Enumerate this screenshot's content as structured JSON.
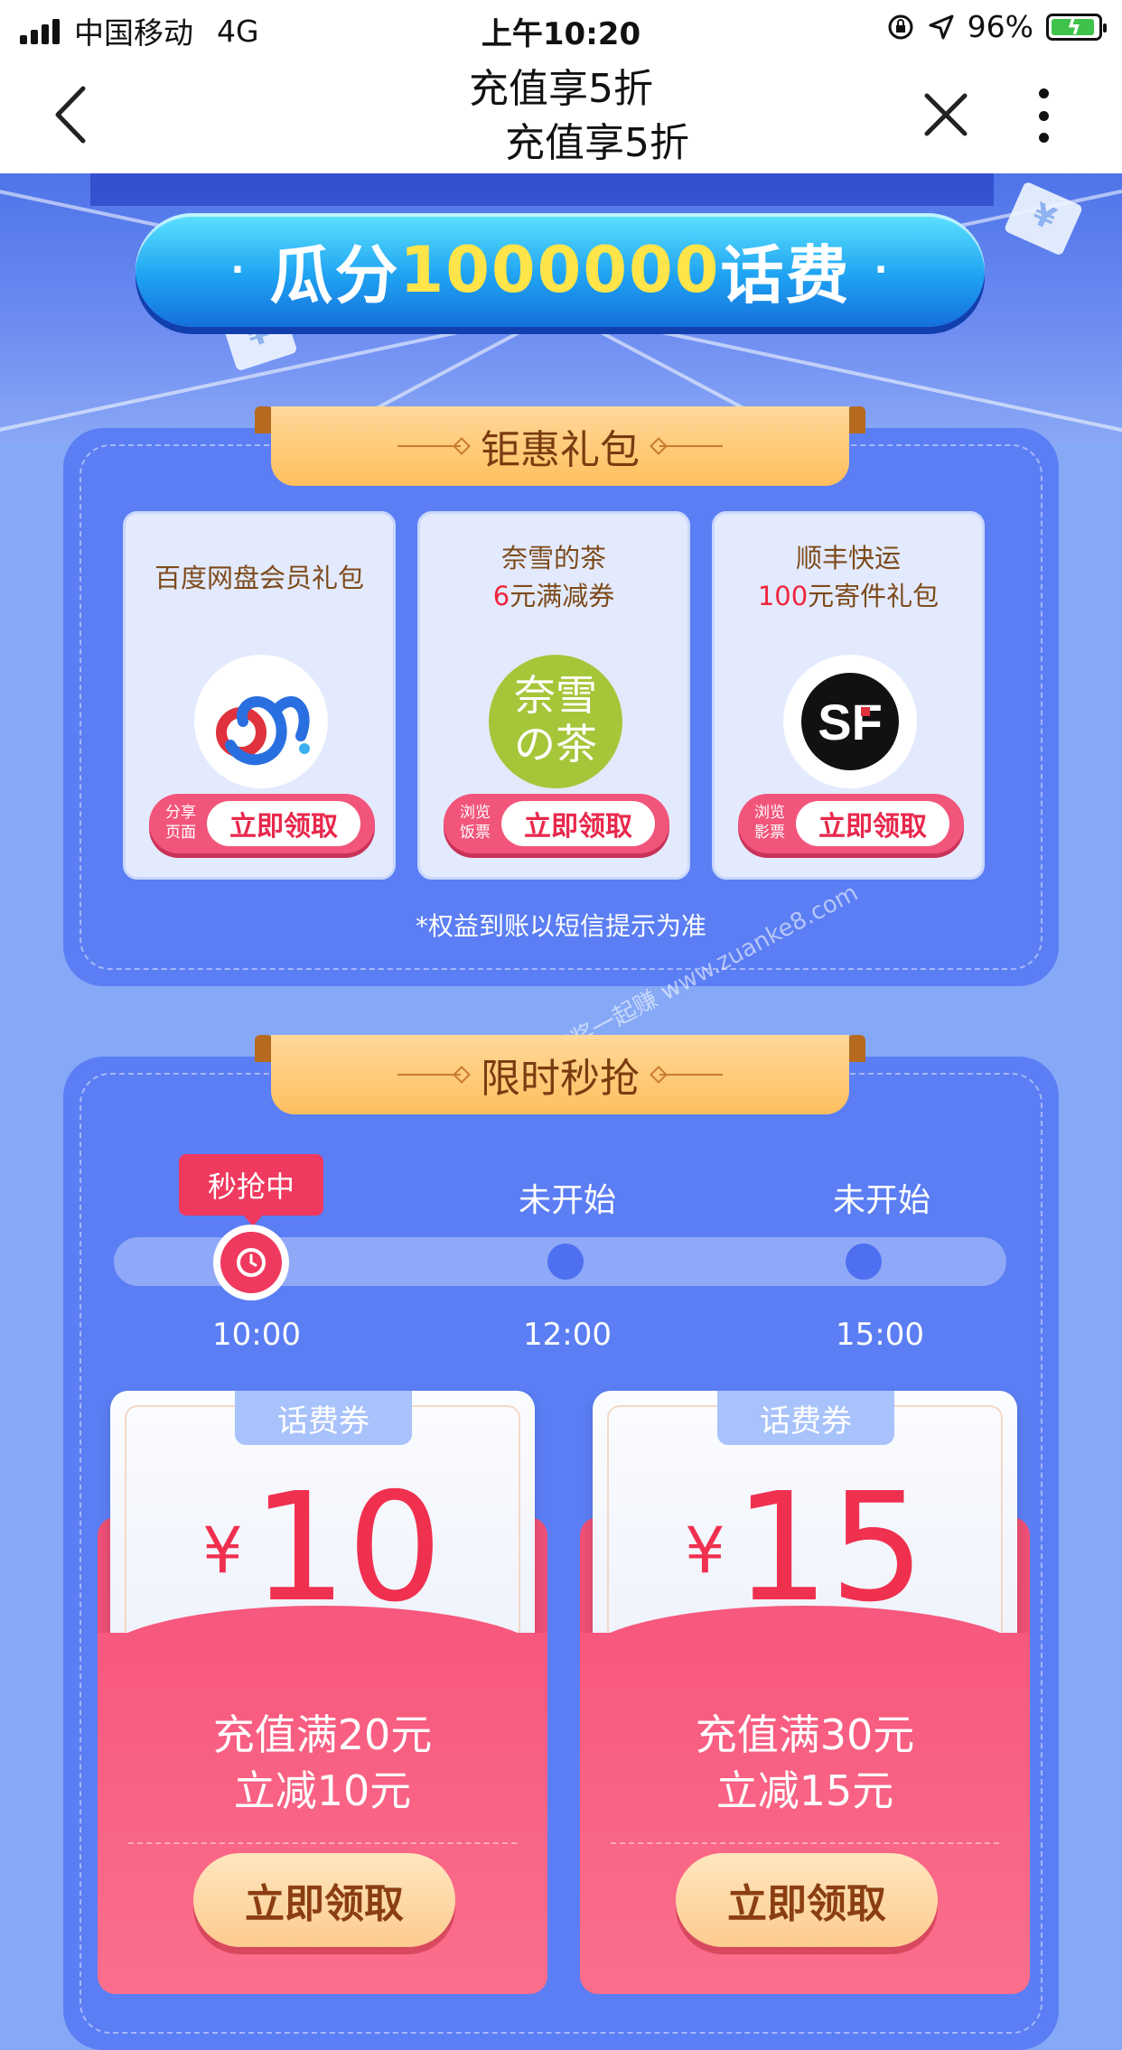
{
  "status_bar": {
    "carrier": "中国移动",
    "network": "4G",
    "time": "上午10:20",
    "battery": "96%"
  },
  "nav": {
    "title": "充值享5折",
    "title_echo": "充值享5折"
  },
  "hero": {
    "banner_prefix": "瓜分",
    "banner_number": "1000000",
    "banner_suffix": "话费",
    "bullet": "·",
    "paper_symbol": "¥"
  },
  "gift_section": {
    "title": "钜惠礼包",
    "cards": [
      {
        "line1": "百度网盘会员礼包",
        "line2_red": "",
        "line2_rest": "",
        "side": "分享页面",
        "button": "立即领取",
        "logo": "baidu-netdisk-logo-icon"
      },
      {
        "line1": "奈雪的茶",
        "line2_red": "6",
        "line2_rest": "元满减券",
        "side": "浏览饭票",
        "button": "立即领取",
        "logo": "nayuki-tea-logo-icon",
        "logo_text": "奈雪の茶"
      },
      {
        "line1": "顺丰快运",
        "line2_red": "100",
        "line2_rest": "元寄件礼包",
        "side": "浏览影票",
        "button": "立即领取",
        "logo": "sf-express-logo-icon",
        "logo_text": "SF"
      }
    ],
    "note": "*权益到账以短信提示为准"
  },
  "flash_section": {
    "title": "限时秒抢",
    "active_badge": "秒抢中",
    "slots": [
      {
        "time": "10:00",
        "status": "秒抢中"
      },
      {
        "time": "12:00",
        "status": "未开始"
      },
      {
        "time": "15:00",
        "status": "未开始"
      }
    ],
    "coupons": [
      {
        "tag": "话费券",
        "currency": "¥",
        "amount": "10",
        "line1": "充值满20元",
        "line2": "立减10元",
        "button": "立即领取"
      },
      {
        "tag": "话费券",
        "currency": "¥",
        "amount": "15",
        "line1": "充值满30元",
        "line2": "立减15元",
        "button": "立即领取"
      }
    ]
  },
  "watermark": "赚客吧，有奖一起赚 www.zuanke8.com",
  "colors": {
    "panel": "#5b7ef4",
    "accent_red": "#f0395e",
    "ribbon": "#ffbf5e",
    "banner_number": "#ffe44a"
  }
}
